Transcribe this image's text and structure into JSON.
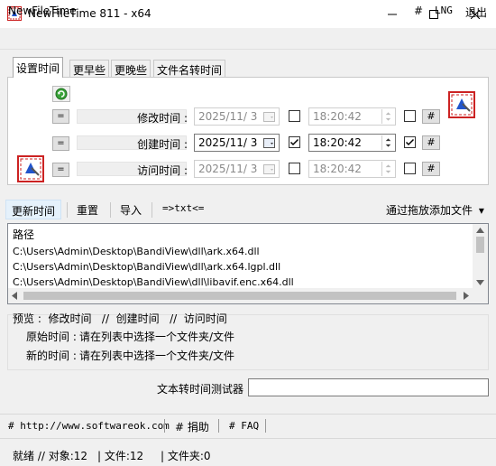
{
  "window": {
    "title": "NewFileTime 811 - x64",
    "minimize_glyph": "—",
    "maximize_glyph": "☐",
    "close_glyph": "✕"
  },
  "menu": {
    "app_name": "NewFileTime",
    "hash": "#",
    "lng": "LNG",
    "exit": "退出"
  },
  "tabs": [
    {
      "label": "设置时间",
      "active": true
    },
    {
      "label": "更早些"
    },
    {
      "label": "更晚些"
    },
    {
      "label": "文件名转时间"
    }
  ],
  "time_rows": [
    {
      "eq": "=",
      "label": "修改时间 :",
      "date": "2025/11/  3",
      "time": "18:20:42",
      "date_checked": false,
      "time_checked": false,
      "enabled": false,
      "hash": "#"
    },
    {
      "eq": "=",
      "label": "创建时间 :",
      "date": "2025/11/  3",
      "time": "18:20:42",
      "date_checked": true,
      "time_checked": true,
      "enabled": true,
      "hash": "#"
    },
    {
      "eq": "=",
      "label": "访问时间 :",
      "date": "2025/11/  3",
      "time": "18:20:42",
      "date_checked": false,
      "time_checked": false,
      "enabled": false,
      "hash": "#"
    }
  ],
  "toolbar": {
    "update": "更新时间",
    "reset": "重置",
    "import": "导入",
    "txt": "=>txt<=",
    "drag_add": "通过拖放添加文件",
    "drag_arrow": "▾"
  },
  "list": {
    "header": "路径",
    "rows": [
      "C:\\Users\\Admin\\Desktop\\BandiView\\dll\\ark.x64.dll",
      "C:\\Users\\Admin\\Desktop\\BandiView\\dll\\ark.x64.lgpl.dll",
      "C:\\Users\\Admin\\Desktop\\BandiView\\dll\\libavif.enc.x64.dll"
    ]
  },
  "preview": {
    "line1": "预览 :  修改时间   //  创建时间   //  访问时间",
    "original_label": "原始时间 :",
    "original_value": "请在列表中选择一个文件夹/文件",
    "new_label": "新的时间 :",
    "new_value": "请在列表中选择一个文件夹/文件"
  },
  "tester": {
    "label": "文本转时间测试器",
    "value": ""
  },
  "links": {
    "website": "# http://www.softwareok.com",
    "donate": "# 捐助",
    "faq": "# FAQ"
  },
  "status": {
    "ready": "就绪 // 对象:12",
    "files": "| 文件:12",
    "folders": "| 文件夹:0"
  },
  "colors": {
    "accent": "#0078d7",
    "select_bg": "#e5f1fb",
    "icon_red": "#cc2222",
    "icon_blue": "#2255cc"
  }
}
